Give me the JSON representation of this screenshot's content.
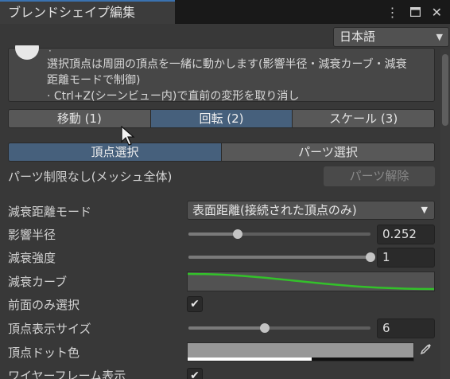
{
  "window": {
    "tab_title": "ブレンドシェイプ編集",
    "menu_icon": "kebab-menu-icon",
    "maximize_icon": "maximize-icon",
    "close_icon": "close-icon"
  },
  "language": {
    "selected": "日本語"
  },
  "help": {
    "dot": "·",
    "lines": [
      "選択頂点は周囲の頂点を一緒に動かします(影響半径・減衰カーブ・減衰",
      "距離モードで制御)",
      "· Ctrl+Z(シーンビュー内)で直前の変形を取り消し"
    ]
  },
  "transform_modes": {
    "options": [
      "移動 (1)",
      "回転 (2)",
      "スケール (3)"
    ],
    "active_index": 1
  },
  "selection_modes": {
    "options": [
      "頂点選択",
      "パーツ選択"
    ],
    "active_index": 0
  },
  "part_limit": {
    "label": "パーツ制限なし(メッシュ全体)",
    "release_button": "パーツ解除"
  },
  "settings": {
    "falloff_mode": {
      "label": "減衰距離モード",
      "value": "表面距離(接続された頂点のみ)"
    },
    "influence_radius": {
      "label": "影響半径",
      "value": "0.252",
      "fraction": 0.27
    },
    "falloff_strength": {
      "label": "減衰強度",
      "value": "1",
      "fraction": 1.0
    },
    "falloff_curve": {
      "label": "減衰カーブ",
      "color": "#33c12a"
    },
    "front_only": {
      "label": "前面のみ選択",
      "checked": true
    },
    "vertex_size": {
      "label": "頂点表示サイズ",
      "value": "6",
      "fraction": 0.42
    },
    "vertex_color": {
      "label": "頂点ドット色",
      "color": "#989898",
      "alpha": 0.55
    },
    "wireframe": {
      "label": "ワイヤーフレーム表示",
      "checked": true
    }
  },
  "colors": {
    "accent": "#46607c",
    "tab_highlight": "#3a72b0"
  }
}
